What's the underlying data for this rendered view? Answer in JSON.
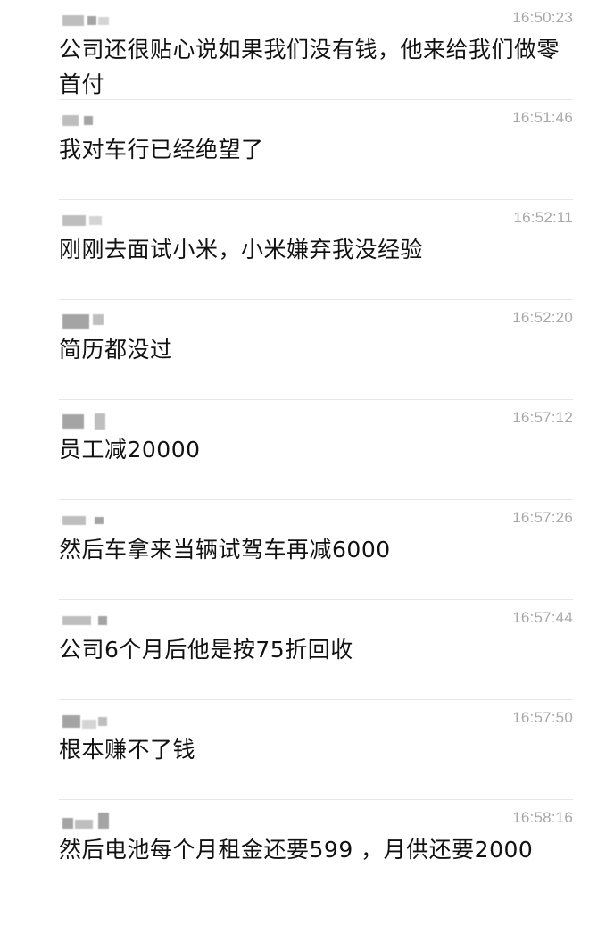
{
  "messages": [
    {
      "time": "16:50:23",
      "text": "公司还很贴心说如果我们没有钱，他来给我们做零首付"
    },
    {
      "time": "16:51:46",
      "text": "我对车行已经绝望了"
    },
    {
      "time": "16:52:11",
      "text": "刚刚去面试小米，小米嫌弃我没经验"
    },
    {
      "time": "16:52:20",
      "text": "简历都没过"
    },
    {
      "time": "16:57:12",
      "text": "员工减20000"
    },
    {
      "time": "16:57:26",
      "text": "然后车拿来当辆试驾车再减6000"
    },
    {
      "time": "16:57:44",
      "text": "公司6个月后他是按75折回收"
    },
    {
      "time": "16:57:50",
      "text": "根本赚不了钱"
    },
    {
      "time": "16:58:16",
      "text": "然后电池每个月租金还要599  ，月供还要2000"
    }
  ]
}
